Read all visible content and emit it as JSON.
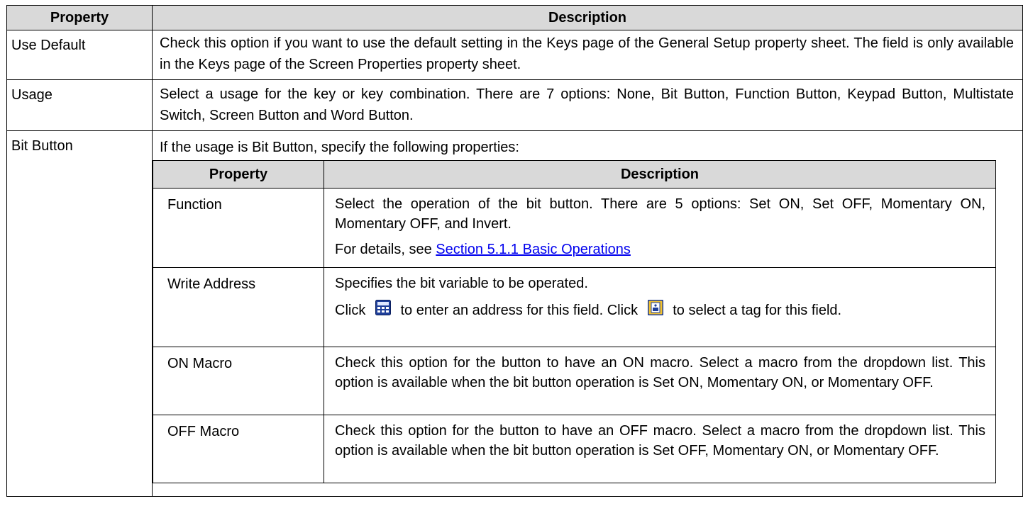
{
  "header": {
    "property": "Property",
    "description": "Description"
  },
  "rows": [
    {
      "property": "Use Default",
      "description": "Check this option if you want to use the default setting in the Keys page of the General Setup property sheet. The field is only available in the Keys page of the Screen Properties property sheet."
    },
    {
      "property": "Usage",
      "description": "Select a usage for the key or key combination. There are 7 options: None, Bit Button, Function Button, Keypad Button, Multistate Switch, Screen Button and Word Button."
    },
    {
      "property": "Bit Button",
      "intro": "If the usage is Bit Button, specify the following properties:"
    }
  ],
  "bit_table": {
    "header": {
      "property": "Property",
      "description": "Description"
    },
    "rows": [
      {
        "property": "Function",
        "description": "Select the operation of the bit button. There are 5 options: Set ON, Set OFF, Momentary ON, Momentary OFF, and Invert.",
        "details_prefix": "For details, see ",
        "details_link": "Section 5.1.1 Basic Operations"
      },
      {
        "property": "Write Address",
        "description": "Specifies the bit variable to be operated.",
        "click1": "Click",
        "after_icon1": "to enter an address for this field. Click",
        "after_icon2": "to select a tag for this field.",
        "icon1": "calculator-icon",
        "icon2": "tag-icon"
      },
      {
        "property": "ON Macro",
        "description": "Check this option for the button to have an ON macro. Select a macro from the dropdown list. This option is available when the bit button operation is Set ON, Momentary ON, or Momentary OFF."
      },
      {
        "property": "OFF Macro",
        "description": "Check this option for the button to have an OFF macro. Select a macro from the dropdown list. This option is available when the bit button operation is Set OFF, Momentary ON, or Momentary OFF."
      }
    ]
  }
}
